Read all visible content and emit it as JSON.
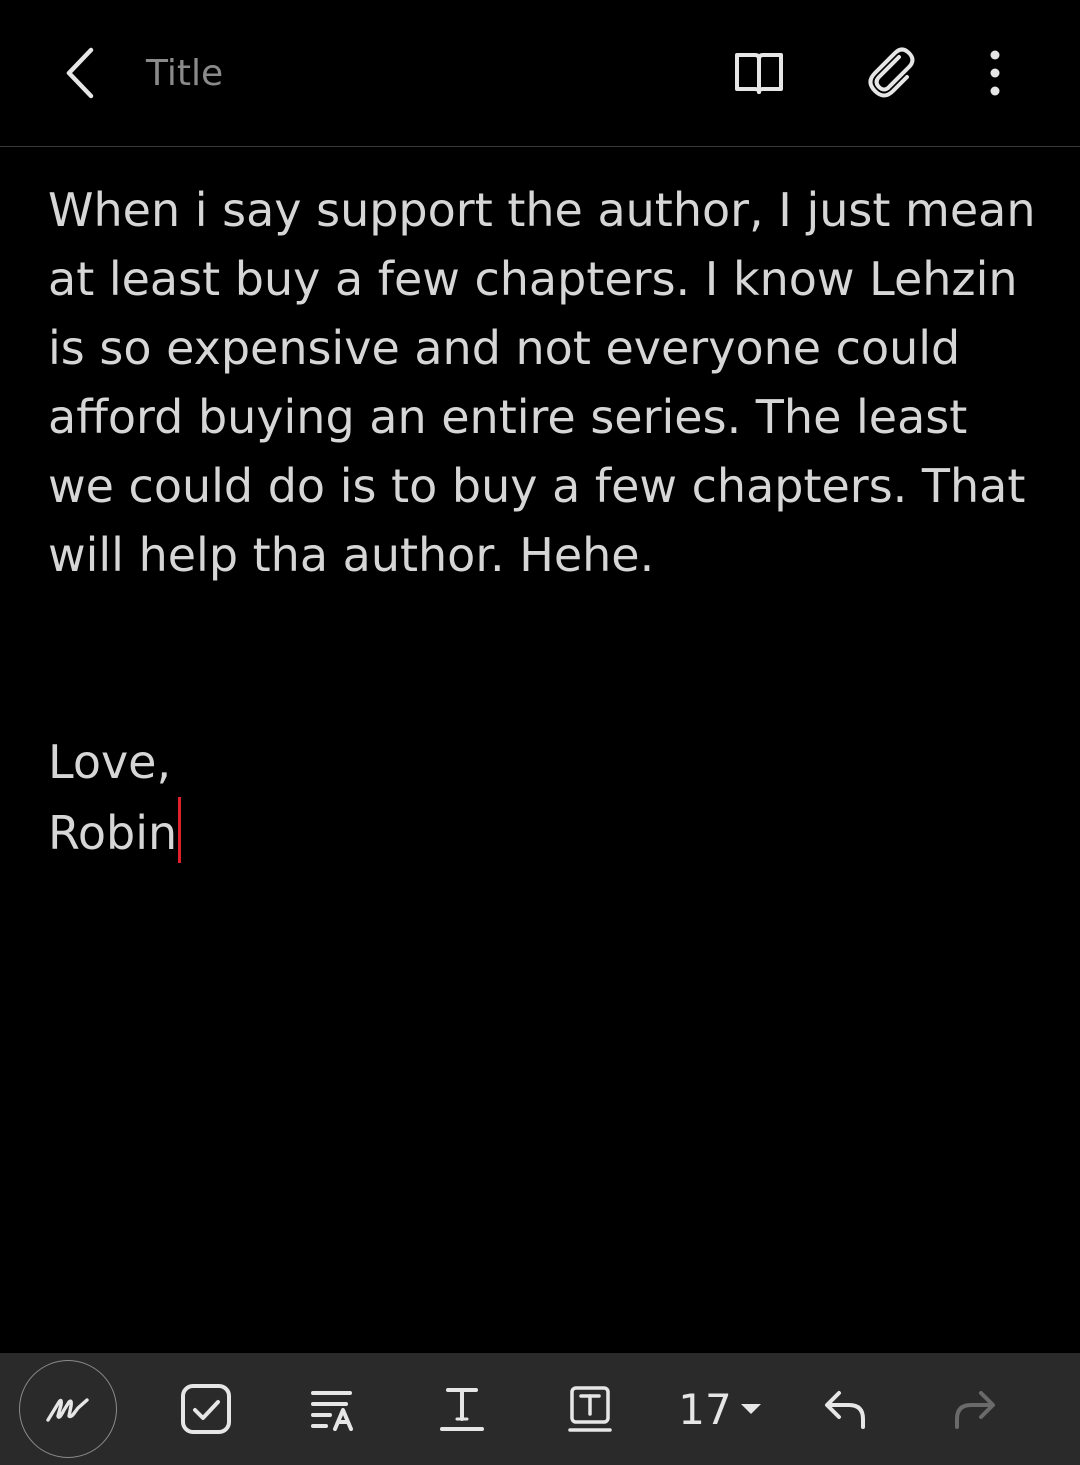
{
  "header": {
    "back_icon": "chevron-left-icon",
    "title_placeholder": "Title",
    "reading_mode_icon": "open-book-icon",
    "attach_icon": "paperclip-icon",
    "more_icon": "more-vertical-icon"
  },
  "note": {
    "paragraph": "When i say support the author, I just mean at least buy a few chapters. I know Lehzin is so expensive and not everyone could afford buying an entire series. The least we could do is to buy a few chapters. That will help tha author. Hehe.",
    "closing": "Love,",
    "signature": "Robin",
    "cursor_color": "#e0202a"
  },
  "toolbar": {
    "pen_icon": "handwriting-pen-icon",
    "checkbox_icon": "checkbox-icon",
    "style_icon": "text-style-icon",
    "text_format_icon": "text-format-icon",
    "textbox_icon": "text-box-icon",
    "font_size": "17",
    "undo_icon": "undo-icon",
    "redo_icon": "redo-icon"
  },
  "colors": {
    "background": "#000000",
    "toolbar_background": "#2a2a2a",
    "text": "#d6d6d6",
    "placeholder": "#8a8a8a",
    "disabled": "#6a6a6a"
  }
}
